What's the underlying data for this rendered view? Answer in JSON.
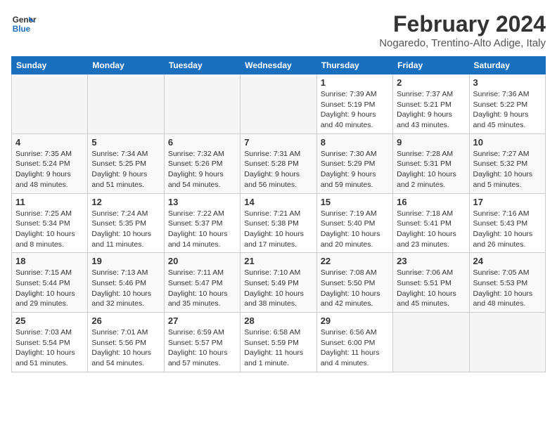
{
  "header": {
    "logo_line1": "General",
    "logo_line2": "Blue",
    "title": "February 2024",
    "subtitle": "Nogaredo, Trentino-Alto Adige, Italy"
  },
  "weekdays": [
    "Sunday",
    "Monday",
    "Tuesday",
    "Wednesday",
    "Thursday",
    "Friday",
    "Saturday"
  ],
  "weeks": [
    [
      {
        "day": "",
        "info": ""
      },
      {
        "day": "",
        "info": ""
      },
      {
        "day": "",
        "info": ""
      },
      {
        "day": "",
        "info": ""
      },
      {
        "day": "1",
        "info": "Sunrise: 7:39 AM\nSunset: 5:19 PM\nDaylight: 9 hours\nand 40 minutes."
      },
      {
        "day": "2",
        "info": "Sunrise: 7:37 AM\nSunset: 5:21 PM\nDaylight: 9 hours\nand 43 minutes."
      },
      {
        "day": "3",
        "info": "Sunrise: 7:36 AM\nSunset: 5:22 PM\nDaylight: 9 hours\nand 45 minutes."
      }
    ],
    [
      {
        "day": "4",
        "info": "Sunrise: 7:35 AM\nSunset: 5:24 PM\nDaylight: 9 hours\nand 48 minutes."
      },
      {
        "day": "5",
        "info": "Sunrise: 7:34 AM\nSunset: 5:25 PM\nDaylight: 9 hours\nand 51 minutes."
      },
      {
        "day": "6",
        "info": "Sunrise: 7:32 AM\nSunset: 5:26 PM\nDaylight: 9 hours\nand 54 minutes."
      },
      {
        "day": "7",
        "info": "Sunrise: 7:31 AM\nSunset: 5:28 PM\nDaylight: 9 hours\nand 56 minutes."
      },
      {
        "day": "8",
        "info": "Sunrise: 7:30 AM\nSunset: 5:29 PM\nDaylight: 9 hours\nand 59 minutes."
      },
      {
        "day": "9",
        "info": "Sunrise: 7:28 AM\nSunset: 5:31 PM\nDaylight: 10 hours\nand 2 minutes."
      },
      {
        "day": "10",
        "info": "Sunrise: 7:27 AM\nSunset: 5:32 PM\nDaylight: 10 hours\nand 5 minutes."
      }
    ],
    [
      {
        "day": "11",
        "info": "Sunrise: 7:25 AM\nSunset: 5:34 PM\nDaylight: 10 hours\nand 8 minutes."
      },
      {
        "day": "12",
        "info": "Sunrise: 7:24 AM\nSunset: 5:35 PM\nDaylight: 10 hours\nand 11 minutes."
      },
      {
        "day": "13",
        "info": "Sunrise: 7:22 AM\nSunset: 5:37 PM\nDaylight: 10 hours\nand 14 minutes."
      },
      {
        "day": "14",
        "info": "Sunrise: 7:21 AM\nSunset: 5:38 PM\nDaylight: 10 hours\nand 17 minutes."
      },
      {
        "day": "15",
        "info": "Sunrise: 7:19 AM\nSunset: 5:40 PM\nDaylight: 10 hours\nand 20 minutes."
      },
      {
        "day": "16",
        "info": "Sunrise: 7:18 AM\nSunset: 5:41 PM\nDaylight: 10 hours\nand 23 minutes."
      },
      {
        "day": "17",
        "info": "Sunrise: 7:16 AM\nSunset: 5:43 PM\nDaylight: 10 hours\nand 26 minutes."
      }
    ],
    [
      {
        "day": "18",
        "info": "Sunrise: 7:15 AM\nSunset: 5:44 PM\nDaylight: 10 hours\nand 29 minutes."
      },
      {
        "day": "19",
        "info": "Sunrise: 7:13 AM\nSunset: 5:46 PM\nDaylight: 10 hours\nand 32 minutes."
      },
      {
        "day": "20",
        "info": "Sunrise: 7:11 AM\nSunset: 5:47 PM\nDaylight: 10 hours\nand 35 minutes."
      },
      {
        "day": "21",
        "info": "Sunrise: 7:10 AM\nSunset: 5:49 PM\nDaylight: 10 hours\nand 38 minutes."
      },
      {
        "day": "22",
        "info": "Sunrise: 7:08 AM\nSunset: 5:50 PM\nDaylight: 10 hours\nand 42 minutes."
      },
      {
        "day": "23",
        "info": "Sunrise: 7:06 AM\nSunset: 5:51 PM\nDaylight: 10 hours\nand 45 minutes."
      },
      {
        "day": "24",
        "info": "Sunrise: 7:05 AM\nSunset: 5:53 PM\nDaylight: 10 hours\nand 48 minutes."
      }
    ],
    [
      {
        "day": "25",
        "info": "Sunrise: 7:03 AM\nSunset: 5:54 PM\nDaylight: 10 hours\nand 51 minutes."
      },
      {
        "day": "26",
        "info": "Sunrise: 7:01 AM\nSunset: 5:56 PM\nDaylight: 10 hours\nand 54 minutes."
      },
      {
        "day": "27",
        "info": "Sunrise: 6:59 AM\nSunset: 5:57 PM\nDaylight: 10 hours\nand 57 minutes."
      },
      {
        "day": "28",
        "info": "Sunrise: 6:58 AM\nSunset: 5:59 PM\nDaylight: 11 hours\nand 1 minute."
      },
      {
        "day": "29",
        "info": "Sunrise: 6:56 AM\nSunset: 6:00 PM\nDaylight: 11 hours\nand 4 minutes."
      },
      {
        "day": "",
        "info": ""
      },
      {
        "day": "",
        "info": ""
      }
    ]
  ]
}
